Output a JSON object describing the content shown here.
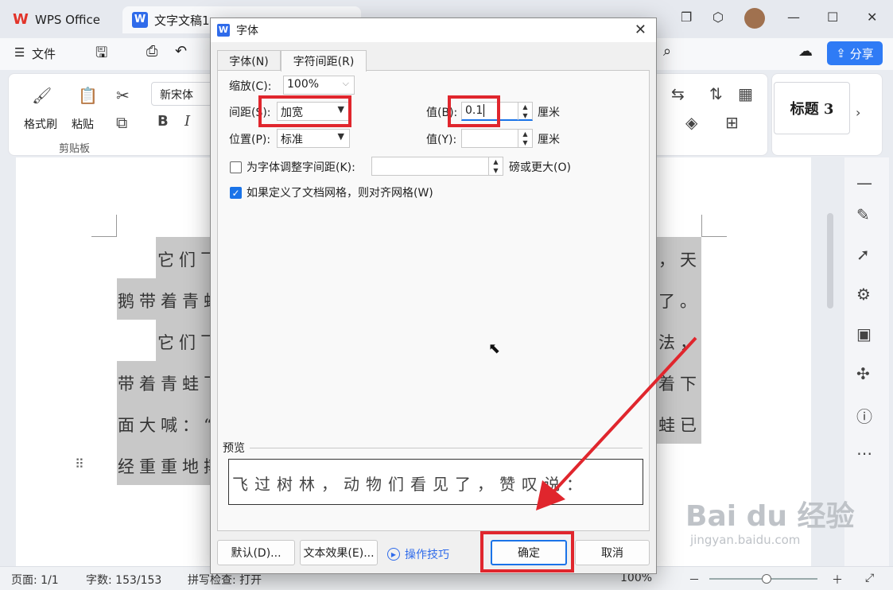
{
  "titlebar": {
    "app_tab": "WPS Office",
    "doc_tab": "文字文稿1",
    "minimize": "—",
    "maximize": "☐",
    "close": "✕"
  },
  "menu": {
    "file_label": "文件",
    "share_label": "分享"
  },
  "ribbon": {
    "format_painter": "格式刷",
    "paste": "粘贴",
    "clipboard_group": "剪贴板",
    "font_name": "新宋体",
    "bold": "B",
    "italic": "I",
    "style_label": "标题 3"
  },
  "document": {
    "lines": [
      {
        "left": "它们飞",
        "right": "，天"
      },
      {
        "left": "鹅带着青蛙",
        "right": "了。"
      },
      {
        "left": "它们飞",
        "right": "法，"
      },
      {
        "left": "带着青蛙飞",
        "right": "着下"
      },
      {
        "left": "面大喊：“",
        "right": "蛙已"
      },
      {
        "left": "经重重地摔",
        "right": ""
      }
    ]
  },
  "status": {
    "page": "页面: 1/1",
    "words": "字数: 153/153",
    "spell": "拼写检查: 打开",
    "zoom": "100%"
  },
  "dialog": {
    "title": "字体",
    "tab_font": "字体(N)",
    "tab_spacing": "字符间距(R)",
    "scale_label": "缩放(C):",
    "scale_value": "100%",
    "spacing_label": "间距(S):",
    "spacing_value": "加宽",
    "value_b_label": "值(B):",
    "value_b": "0.1",
    "unit_cm": "厘米",
    "position_label": "位置(P):",
    "position_value": "标准",
    "value_y_label": "值(Y):",
    "value_y": "",
    "kerning_label": "为字体调整字间距(K):",
    "kerning_value": "",
    "kerning_unit": "磅或更大(O)",
    "kerning_checked": false,
    "grid_label": "如果定义了文档网格，则对齐网格(W)",
    "grid_checked": true,
    "preview_label": "预览",
    "preview_text": "飞过树林，动物们看见了，赞叹说：",
    "btn_default": "默认(D)...",
    "btn_effects": "文本效果(E)...",
    "btn_tips": "操作技巧",
    "btn_ok": "确定",
    "btn_cancel": "取消"
  },
  "watermark": {
    "brand": "Bai du 经验",
    "url": "jingyan.baidu.com"
  },
  "colors": {
    "highlight": "#e0262d",
    "accent": "#2f7bf5"
  }
}
